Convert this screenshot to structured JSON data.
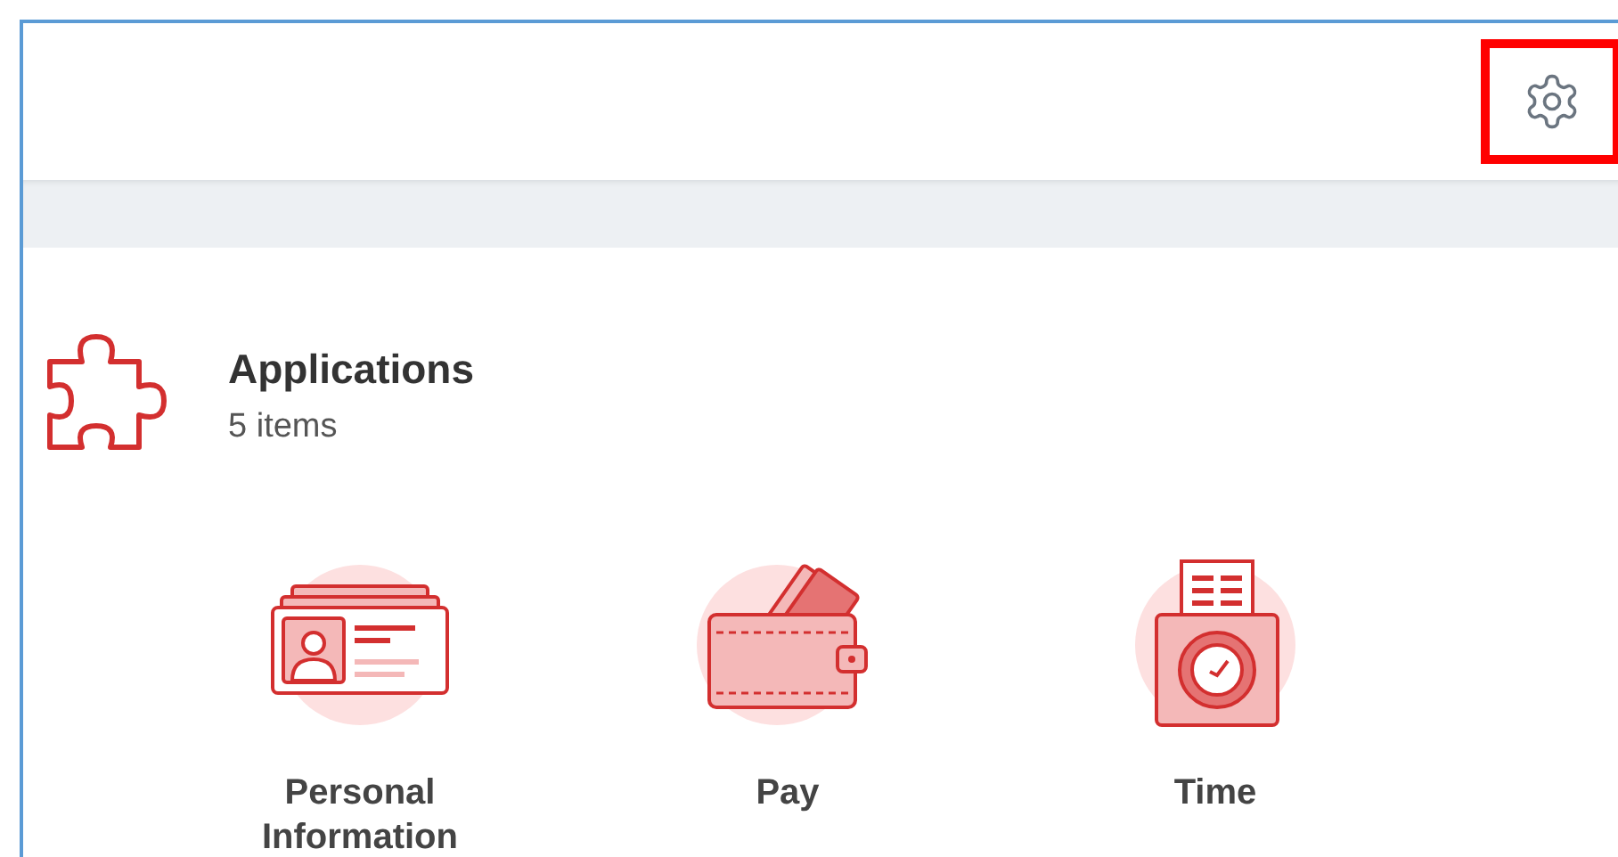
{
  "header": {
    "settings_button": {
      "highlighted": true
    }
  },
  "section": {
    "title": "Applications",
    "count": "5 items"
  },
  "apps": [
    {
      "kind": "id-card",
      "label": "Personal Information"
    },
    {
      "kind": "wallet",
      "label": "Pay"
    },
    {
      "kind": "time-clock",
      "label": "Time"
    }
  ]
}
